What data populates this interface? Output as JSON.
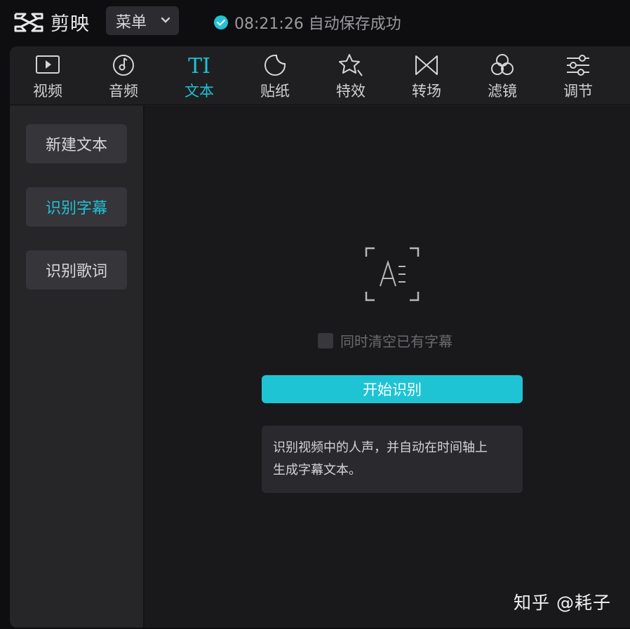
{
  "app": {
    "logo_text": "剪映",
    "menu_label": "菜单",
    "save_status": "08:21:26 自动保存成功"
  },
  "colors": {
    "accent": "#1fc4d4",
    "background": "#0e0e10",
    "panel": "#1f1f22"
  },
  "tabs": [
    {
      "label": "视频",
      "icon": "video-icon"
    },
    {
      "label": "音频",
      "icon": "audio-icon"
    },
    {
      "label": "文本",
      "icon": "text-icon",
      "active": true
    },
    {
      "label": "贴纸",
      "icon": "sticker-icon"
    },
    {
      "label": "特效",
      "icon": "effects-icon"
    },
    {
      "label": "转场",
      "icon": "transition-icon"
    },
    {
      "label": "滤镜",
      "icon": "filter-icon"
    },
    {
      "label": "调节",
      "icon": "adjust-icon"
    }
  ],
  "sidebar": {
    "items": [
      {
        "label": "新建文本"
      },
      {
        "label": "识别字幕",
        "active": true
      },
      {
        "label": "识别歌词"
      }
    ]
  },
  "main": {
    "checkbox_label": "同时清空已有字幕",
    "checkbox_checked": false,
    "start_button": "开始识别",
    "description_line1": "识别视频中的人声，并自动在时间轴上",
    "description_line2": "生成字幕文本。"
  },
  "watermark": "知乎 @耗子"
}
